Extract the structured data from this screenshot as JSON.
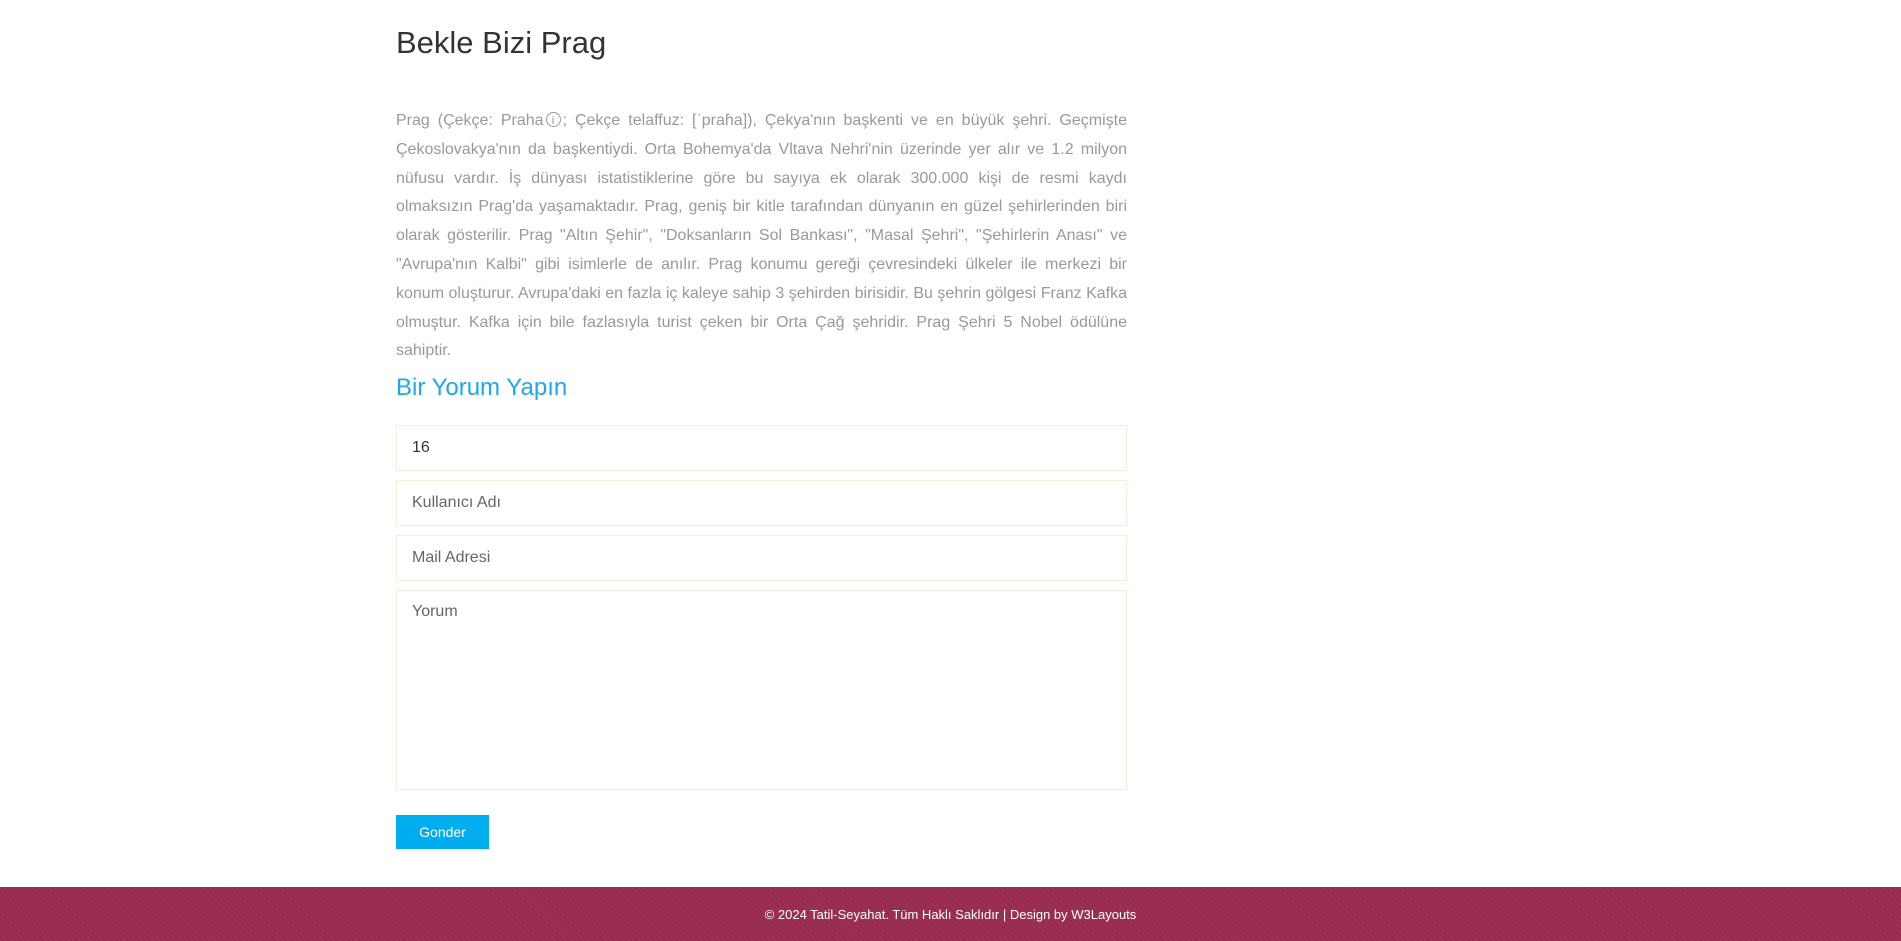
{
  "article": {
    "title": "Bekle Bizi Prag",
    "paragraph_before_icon": "Prag (Çekçe: Praha",
    "info_icon_symbol": "i",
    "paragraph_after_icon": "; Çekçe telaffuz: [ˈpraɦa]), Çekya'nın başkenti ve en büyük şehri. Geçmişte Çekoslovakya'nın da başkentiydi. Orta Bohemya'da Vltava Nehri'nin üzerinde yer alır ve 1.2 milyon nüfusu vardır. İş dünyası istatistiklerine göre bu sayıya ek olarak 300.000 kişi de resmi kaydı olmaksızın Prag'da yaşamaktadır. Prag, geniş bir kitle tarafından dünyanın en güzel şehirlerinden biri olarak gösterilir. Prag \"Altın Şehir\", \"Doksanların Sol Bankası\", \"Masal Şehri\", \"Şehirlerin Anası\" ve \"Avrupa'nın Kalbi\" gibi isimlerle de anılır. Prag konumu gereği çevresindeki ülkeler ile merkezi bir konum oluşturur. Avrupa'daki en fazla iç kaleye sahip 3 şehirden birisidir. Bu şehrin gölgesi Franz Kafka olmuştur. Kafka için bile fazlasıyla turist çeken bir Orta Çağ şehridir. Prag Şehri 5 Nobel ödülüne sahiptir."
  },
  "comment_form": {
    "title": "Bir Yorum Yapın",
    "id_value": "16",
    "username_placeholder": "Kullanıcı Adı",
    "email_placeholder": "Mail Adresi",
    "comment_placeholder": "Yorum",
    "submit_label": "Gonder"
  },
  "footer": {
    "copyright": "© 2024 Tatil-Seyahat. Tüm Haklı Saklıdır | Design by ",
    "link_text": "W3Layouts"
  },
  "colors": {
    "heading_accent": "#1ba8ee",
    "button": "#00aef0",
    "footer_bg": "#9b2c50",
    "paragraph_text": "#999999",
    "field_border": "#f3f0d8"
  }
}
